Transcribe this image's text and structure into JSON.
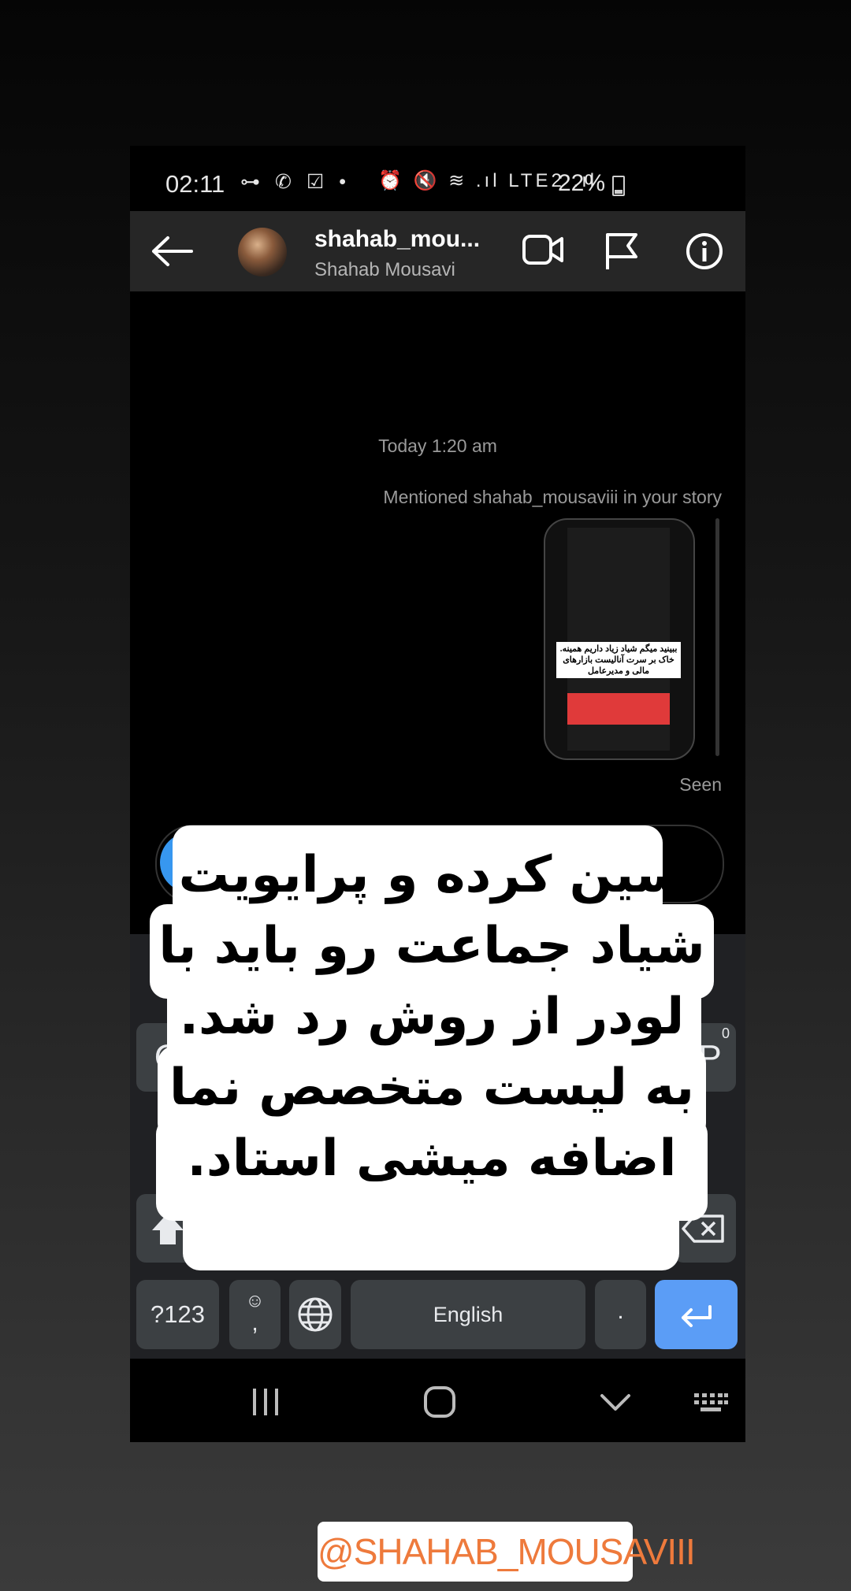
{
  "status_bar": {
    "time": "02:11",
    "left_icons": "⊶ ✆ ☑ •",
    "right_icons": "⏰ 🔇 ≋ .ıl LTE2 .ıl",
    "battery": "22%"
  },
  "header": {
    "username": "shahab_mou...",
    "full_name": "Shahab Mousavi"
  },
  "chat": {
    "timestamp": "Today 1:20 am",
    "mention_text": "Mentioned shahab_mousaviii in your story",
    "story_caption": "ببینید میگم شیاد زیاد داریم همینه. خاک بر سرت آنالیست بازارهای مالی و مدیرعامل",
    "seen_label": "Seen"
  },
  "keyboard": {
    "key_q": "Q",
    "key_p": "P",
    "key_p_hint": "0",
    "key_symbols": "?123",
    "key_emoji": "☺",
    "key_comma": ",",
    "key_space": "English",
    "key_period": "."
  },
  "overlay": {
    "lines": [
      "سین کرده و پرایویت",
      "شیاد جماعت رو باید با",
      "لودر از روش رد شد.",
      "به لیست متخصص نما",
      "اضافه میشی استاد."
    ]
  },
  "handle_sticker": "@SHAHAB_MOUSAVIII",
  "colors": {
    "enter_key": "#5b9df6",
    "handle_text": "#ee7a3c",
    "header_bg": "#262626"
  },
  "icons": [
    "key-icon",
    "whatsapp-icon",
    "check-icon",
    "alarm-icon",
    "mute-icon",
    "wifi-icon",
    "signal-icon",
    "battery-icon",
    "back-arrow-icon",
    "video-call-icon",
    "flag-icon",
    "info-icon",
    "shift-icon",
    "backspace-icon",
    "globe-icon",
    "enter-icon",
    "recents-icon",
    "home-icon",
    "hide-keyboard-icon",
    "keyboard-icon"
  ]
}
